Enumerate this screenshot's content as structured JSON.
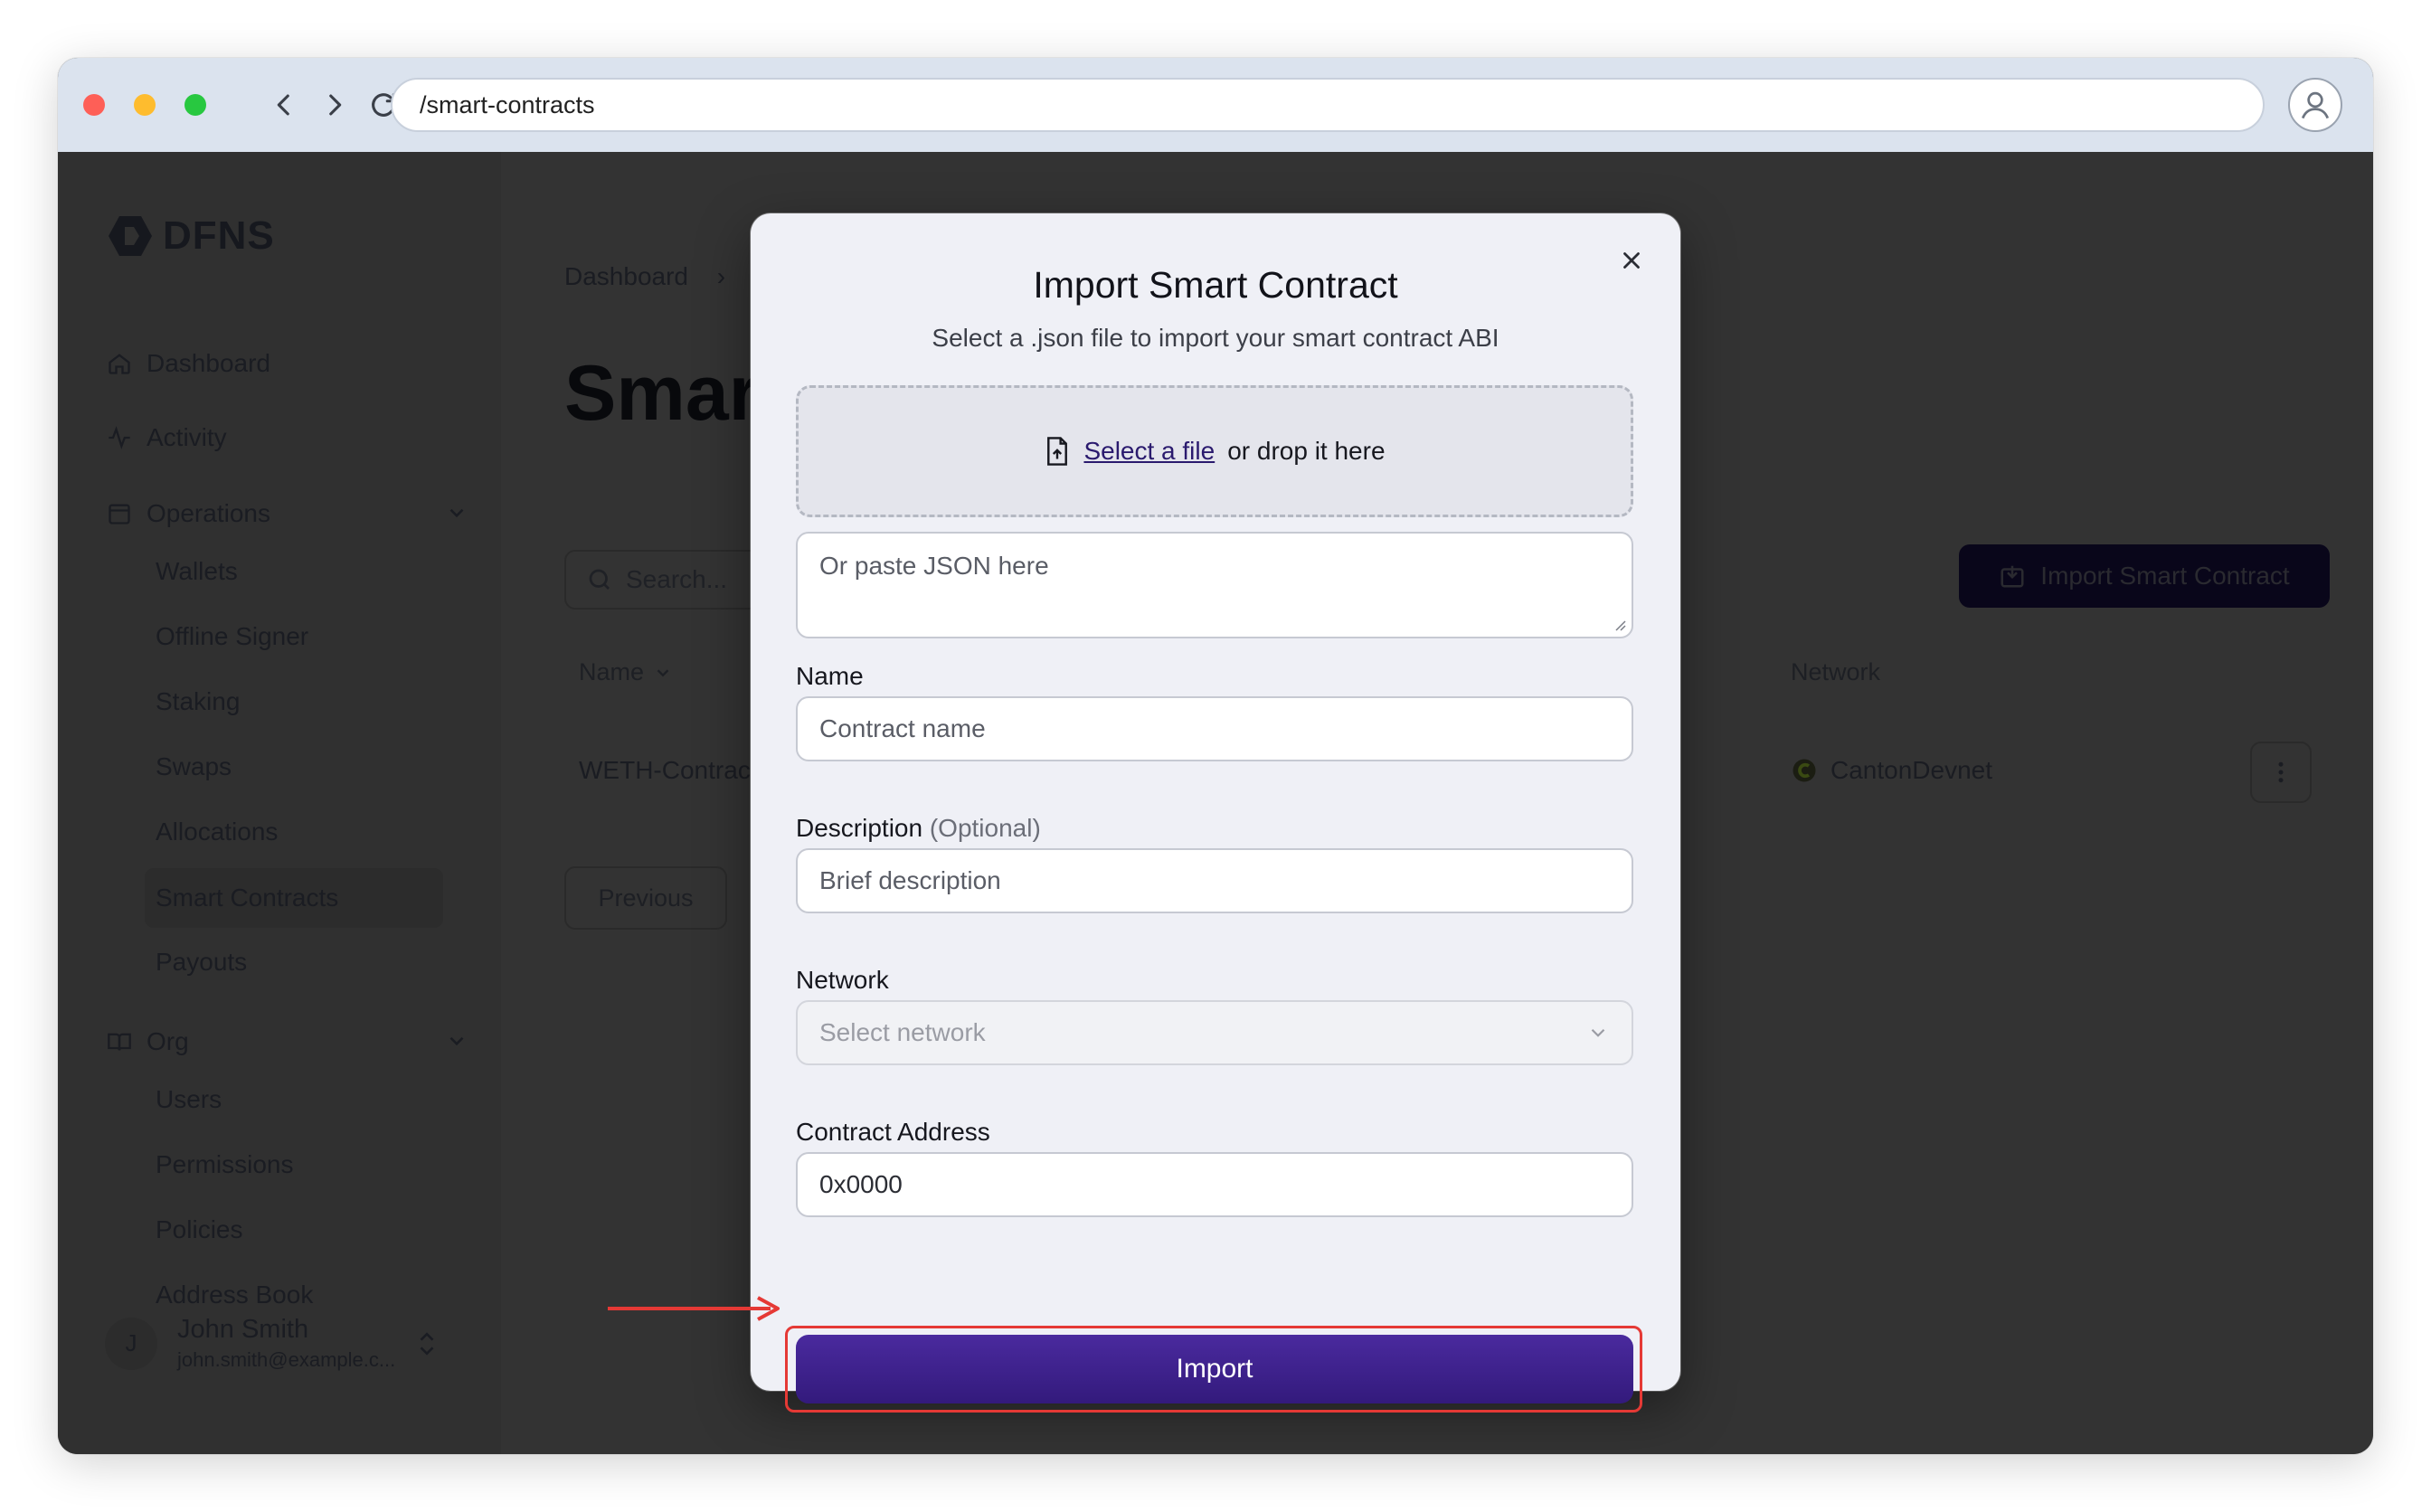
{
  "browser": {
    "url": "/smart-contracts"
  },
  "sidebar": {
    "logo_text": "DFNS",
    "top_items": [
      {
        "label": "Dashboard",
        "icon": "home-icon"
      },
      {
        "label": "Activity",
        "icon": "activity-icon"
      }
    ],
    "operations": {
      "label": "Operations",
      "icon": "calendar-icon",
      "items": [
        "Wallets",
        "Offline Signer",
        "Staking",
        "Swaps",
        "Allocations",
        "Smart Contracts",
        "Payouts"
      ],
      "active": "Smart Contracts"
    },
    "org": {
      "label": "Org",
      "icon": "book-icon",
      "items": [
        "Users",
        "Permissions",
        "Policies",
        "Address Book"
      ]
    },
    "user": {
      "initial": "J",
      "name": "John Smith",
      "email": "john.smith@example.c..."
    }
  },
  "main": {
    "breadcrumb_first": "Dashboard",
    "page_title": "Smar",
    "search_placeholder": "Search...",
    "import_button": "Import Smart Contract",
    "columns": {
      "name": "Name",
      "network": "Network"
    },
    "row": {
      "name": "WETH-Contrac",
      "network": "CantonDevnet"
    },
    "previous_button": "Previous"
  },
  "modal": {
    "title": "Import Smart Contract",
    "subtitle": "Select a .json file to import your smart contract ABI",
    "dropzone": {
      "link": "Select a file",
      "rest": "or drop it here"
    },
    "json_placeholder": "Or paste JSON here",
    "name_label": "Name",
    "name_placeholder": "Contract name",
    "description_label": "Description",
    "description_optional": "(Optional)",
    "description_placeholder": "Brief description",
    "network_label": "Network",
    "network_placeholder": "Select network",
    "address_label": "Contract Address",
    "address_value": "0x0000",
    "import_button": "Import"
  },
  "colors": {
    "accent": "#3d2190",
    "highlight": "#e53935"
  }
}
